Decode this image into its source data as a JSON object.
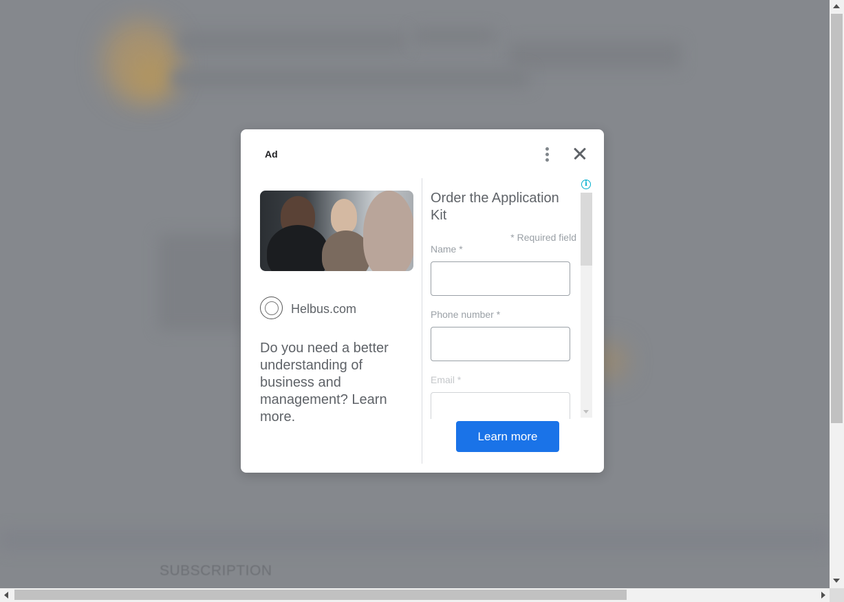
{
  "background": {
    "footer_heading": "SUBSCRIPTION"
  },
  "ad": {
    "label": "Ad",
    "more_icon": "vertical-dots-icon",
    "close_icon": "close-icon",
    "advertiser": "Helbus.com",
    "headline": "Do you need a better understanding of business and management? Learn more.",
    "form": {
      "title": "Order the Application Kit",
      "required_note": "* Required field",
      "fields": [
        {
          "label": "Name *",
          "value": ""
        },
        {
          "label": "Phone number *",
          "value": ""
        },
        {
          "label": "Email *",
          "value": ""
        }
      ],
      "info_icon": "info-icon"
    },
    "cta_label": "Learn more",
    "accent_color": "#1a73e8"
  }
}
